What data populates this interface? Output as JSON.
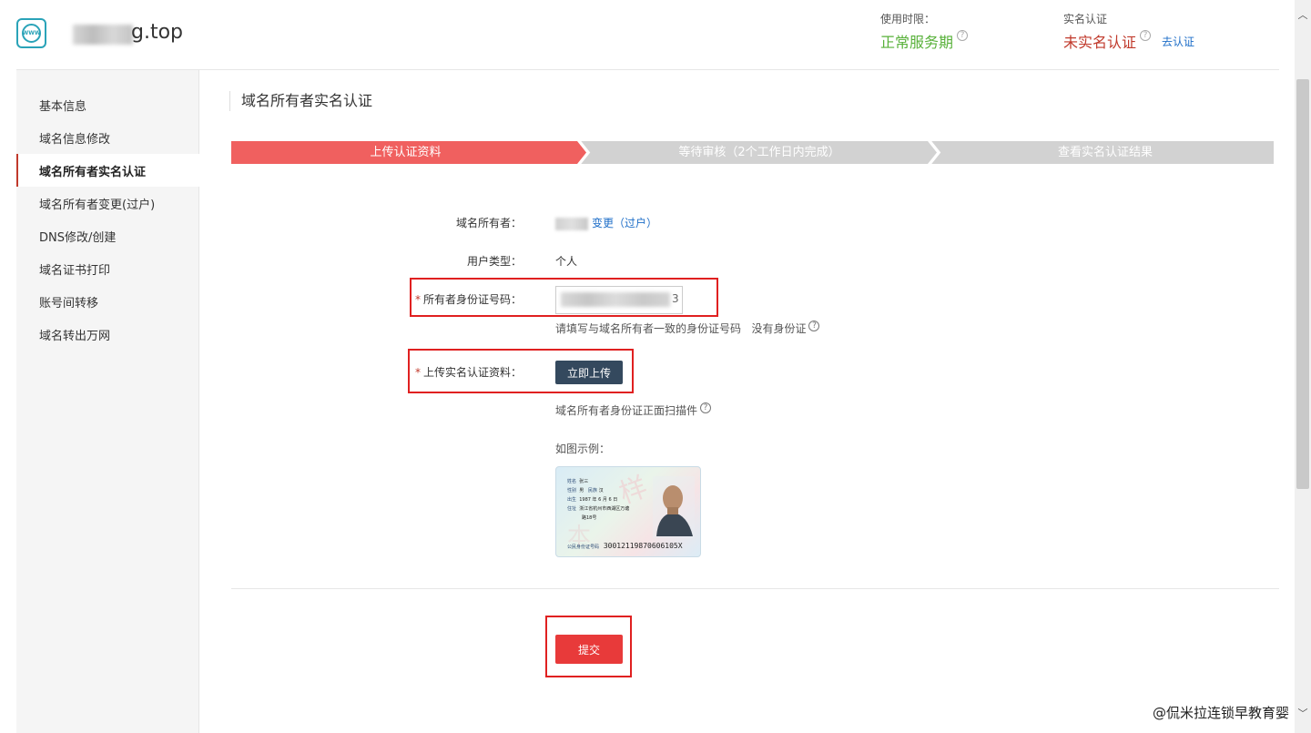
{
  "header": {
    "domain_suffix": "g.top",
    "service_period_label": "使用时限：",
    "service_period_value": "正常服务期",
    "realname_label": "实名认证",
    "realname_value": "未实名认证",
    "go_verify": "去认证",
    "help_glyph": "?"
  },
  "sidebar": {
    "items": [
      {
        "label": "基本信息"
      },
      {
        "label": "域名信息修改"
      },
      {
        "label": "域名所有者实名认证"
      },
      {
        "label": "域名所有者变更(过户)"
      },
      {
        "label": "DNS修改/创建"
      },
      {
        "label": "域名证书打印"
      },
      {
        "label": "账号间转移"
      },
      {
        "label": "域名转出万网"
      }
    ],
    "active_index": 2
  },
  "page": {
    "title": "域名所有者实名认证",
    "steps": [
      "上传认证资料",
      "等待审核（2个工作日内完成）",
      "查看实名认证结果"
    ],
    "current_step": 0
  },
  "form": {
    "owner_label": "域名所有者：",
    "owner_change_link": "变更（过户）",
    "user_type_label": "用户类型：",
    "user_type_value": "个人",
    "id_label": "所有者身份证号码：",
    "required_mark": "*",
    "id_value_tail": "3",
    "id_hint": "请填写与域名所有者一致的身份证号码",
    "no_id_link": "没有身份证",
    "upload_label": "上传实名认证资料：",
    "upload_button": "立即上传",
    "upload_hint": "域名所有者身份证正面扫描件",
    "example_label": "如图示例：",
    "submit_button": "提交"
  },
  "id_card_sample": {
    "rows": [
      {
        "k": "姓名",
        "v": "张三"
      },
      {
        "k": "性别",
        "v": "男"
      },
      {
        "k": "出生",
        "v": "1987 年 6 月 6 日"
      },
      {
        "k": "住址",
        "v": "浙江省杭州市西湖区万塘"
      },
      {
        "k": "",
        "v": "路18号"
      }
    ],
    "ethnic_label": "民族",
    "ethnic_value": "汉",
    "number_label": "公民身份证号码",
    "number_value": "30012119870606105X"
  },
  "watermark": "@侃米拉连锁早教育婴",
  "colors": {
    "step_active": "#f0605f",
    "step_inactive": "#d2d2d2",
    "accent_red": "#e02020",
    "green": "#58b13a",
    "link": "#1e6ec8"
  }
}
